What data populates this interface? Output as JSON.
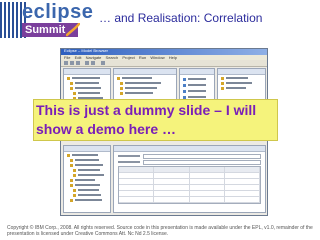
{
  "logo": {
    "wordmark": "eclipse",
    "event": "Summit",
    "icon": "brush-stroke-icon"
  },
  "slide": {
    "title": "… and Realisation: Correlation"
  },
  "screenshot": {
    "window_title": "Eclipse – Model Browser",
    "menu_items": [
      "File",
      "Edit",
      "Navigate",
      "Search",
      "Project",
      "Run",
      "Window",
      "Help"
    ]
  },
  "note": {
    "text": "This is just a dummy slide – I will show a demo here …"
  },
  "footer": {
    "text": "Copyright © IBM Corp., 2008. All rights reserved.  Source code in this presentation is made available under the EPL, v1.0, remainder of the presentation is licensed under Creative Commons Att. Nc Nd 2.5 license."
  },
  "colors": {
    "title": "#2c2c9c",
    "note_bg": "#f5f37c",
    "note_text": "#7a1fb8",
    "summit_bg": "#7b3f9c",
    "eclipse_blue": "#3b66ad"
  }
}
